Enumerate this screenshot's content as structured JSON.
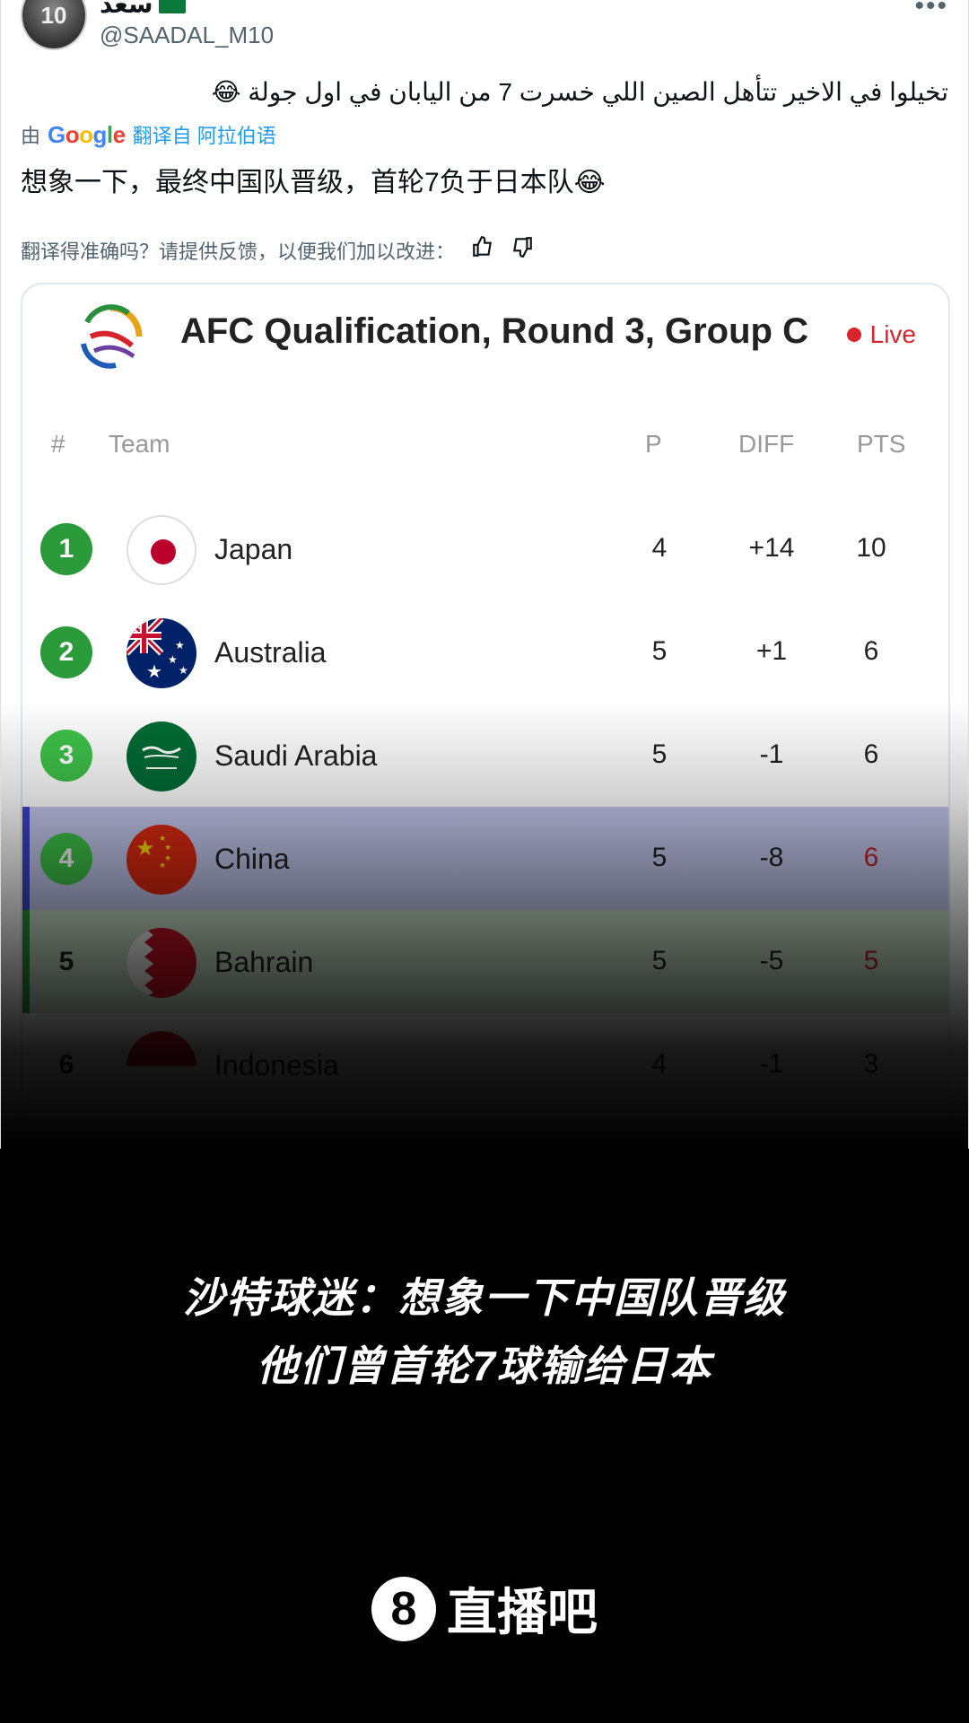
{
  "post": {
    "display_name": "سعد",
    "handle": "@SAADAL_M10",
    "avatar_text": "10",
    "more": "•••",
    "text_original": "تخيلوا في الاخير تتأهل الصين اللي خسرت 7 من اليابان في اول جولة 😂",
    "translate_prefix": "由",
    "translate_link": "翻译自 阿拉伯语",
    "text_translated": "想象一下，最终中国队晋级，首轮7负于日本队😂",
    "feedback_prompt": "翻译得准确吗？请提供反馈，以便我们加以改进："
  },
  "card": {
    "title": "AFC Qualification, Round 3, Group C",
    "live_label": "Live",
    "headers": {
      "rank": "#",
      "team": "Team",
      "p": "P",
      "diff": "DIFF",
      "pts": "PTS"
    },
    "rows": [
      {
        "rank": "1",
        "team": "Japan",
        "p": "4",
        "diff": "+14",
        "pts": "10"
      },
      {
        "rank": "2",
        "team": "Australia",
        "p": "5",
        "diff": "+1",
        "pts": "6"
      },
      {
        "rank": "3",
        "team": "Saudi Arabia",
        "p": "5",
        "diff": "-1",
        "pts": "6"
      },
      {
        "rank": "4",
        "team": "China",
        "p": "5",
        "diff": "-8",
        "pts": "6"
      },
      {
        "rank": "5",
        "team": "Bahrain",
        "p": "5",
        "diff": "-5",
        "pts": "5"
      },
      {
        "rank": "6",
        "team": "Indonesia",
        "p": "4",
        "diff": "-1",
        "pts": "3"
      }
    ],
    "colors": {
      "rank_top": "#2a9a3a",
      "rank_third": "#3fc34a",
      "highlight_blue": "#3a45c8",
      "highlight_green": "#2a9a3a",
      "live_red": "#d9242b"
    }
  },
  "caption": {
    "line1": "沙特球迷：想象一下中国队晋级",
    "line2": "他们曾首轮7球输给日本"
  },
  "brand": {
    "icon": "8",
    "name": "直播吧"
  }
}
